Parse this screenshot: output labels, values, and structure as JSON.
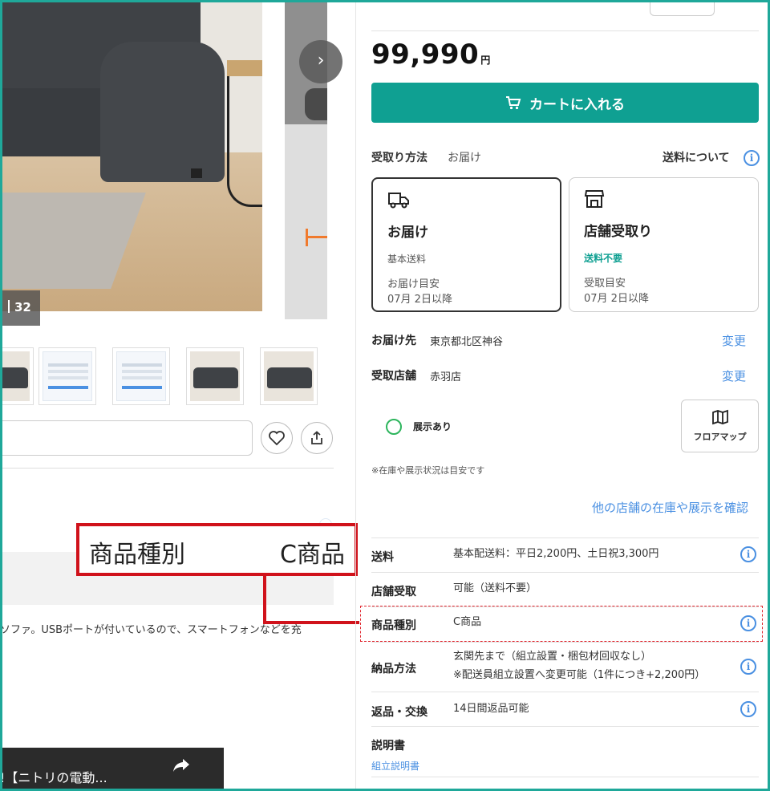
{
  "gallery": {
    "photo_count": "32",
    "next_arrow": "›"
  },
  "description_excerpt": "ソファ。USBポートが付いているので、スマートフォンなどを充",
  "video": {
    "title": "!【ニトリの電動..."
  },
  "callout": {
    "label": "商品種別",
    "value": "C商品"
  },
  "price": {
    "amount": "99,990",
    "currency": "円"
  },
  "cart_button": {
    "label": "カートに入れる",
    "icon": "cart-icon"
  },
  "receive": {
    "label": "受取り方法",
    "value": "お届け",
    "shipping_link": "送料について"
  },
  "options": [
    {
      "title": "お届け",
      "icon": "truck-icon",
      "fee": "基本送料",
      "eta_label": "お届け目安",
      "eta": "07月 2日以降",
      "selected": true
    },
    {
      "title": "店舗受取り",
      "icon": "store-icon",
      "fee": "送料不要",
      "eta_label": "受取目安",
      "eta": "07月 2日以降",
      "selected": false
    }
  ],
  "delivery_to": {
    "label": "お届け先",
    "value": "東京都北区神谷",
    "change": "変更"
  },
  "pickup_store": {
    "label": "受取店舗",
    "value": "赤羽店",
    "change": "変更"
  },
  "stock": {
    "label": "展示あり",
    "floor_map": "フロアマップ",
    "note": "※在庫や展示状況は目安です",
    "other_stores": "他の店舗の在庫や展示を確認"
  },
  "specs": [
    {
      "label": "送料",
      "value": "基本配送料：平日2,200円、土日祝3,300円",
      "info": true
    },
    {
      "label": "店舗受取",
      "value": "可能（送料不要）",
      "info": false
    },
    {
      "label": "商品種別",
      "value": "C商品",
      "info": true
    },
    {
      "label": "納品方法",
      "value": "玄関先まで（組立設置・梱包材回収なし）",
      "value2": "※配送員組立設置へ変更可能（1件につき+2,200円）",
      "info": true
    },
    {
      "label": "返品・交換",
      "value": "14日間返品可能",
      "info": true
    },
    {
      "label": "説明書",
      "link": "組立説明書"
    }
  ],
  "colors": {
    "brand_teal": "#0fa092",
    "frame": "#1fa89a",
    "link_blue": "#4a90e2",
    "callout_red": "#d0121b",
    "stock_green": "#2db55d"
  }
}
